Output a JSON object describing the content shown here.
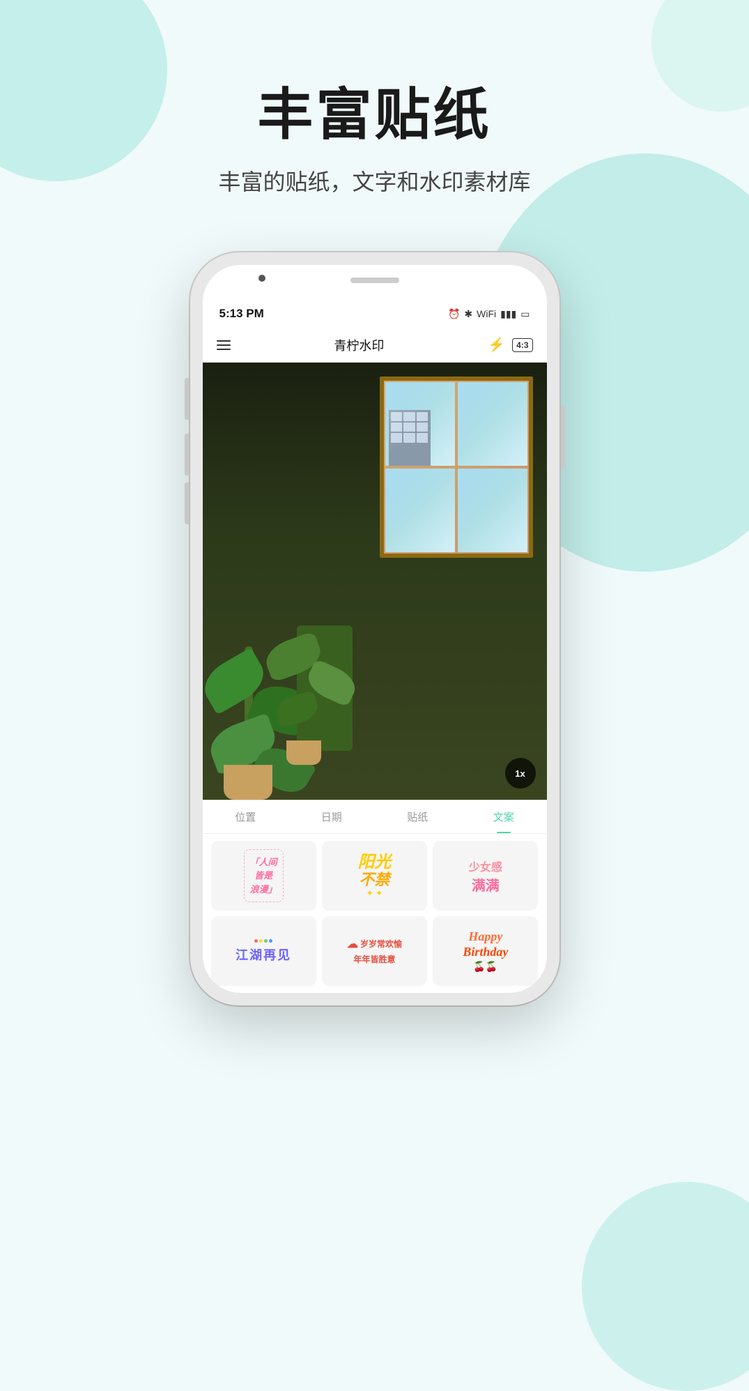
{
  "page": {
    "background_color": "#f0fafa"
  },
  "hero": {
    "title": "丰富贴纸",
    "subtitle": "丰富的贴纸，文字和水印素材库"
  },
  "phone": {
    "status_bar": {
      "time": "5:13 PM",
      "icons": [
        "alarm",
        "bluetooth",
        "wifi",
        "signal",
        "battery"
      ]
    },
    "header": {
      "menu_label": "menu",
      "title": "青柠水印",
      "lightning_label": "lightning",
      "ratio": "4:3"
    },
    "photo": {
      "zoom": "1x"
    },
    "tabs": [
      {
        "id": "location",
        "label": "位置",
        "active": false
      },
      {
        "id": "date",
        "label": "日期",
        "active": false
      },
      {
        "id": "sticker",
        "label": "贴纸",
        "active": false
      },
      {
        "id": "text",
        "label": "文案",
        "active": true
      }
    ],
    "stickers": [
      {
        "id": 1,
        "text": "「人间\n皆是\n浪漫」",
        "style": "romantic-pink"
      },
      {
        "id": 2,
        "text": "阳光\n不禁",
        "style": "sunshine-yellow"
      },
      {
        "id": 3,
        "text": "少女感\n满满",
        "style": "girl-pink"
      },
      {
        "id": 4,
        "text": "江湖再见",
        "style": "jianghu-purple"
      },
      {
        "id": 5,
        "text": "岁岁常欢愉\n年年皆胜意",
        "style": "blessing-red"
      },
      {
        "id": 6,
        "text": "Happy\nBirthday",
        "style": "birthday-orange"
      }
    ]
  }
}
